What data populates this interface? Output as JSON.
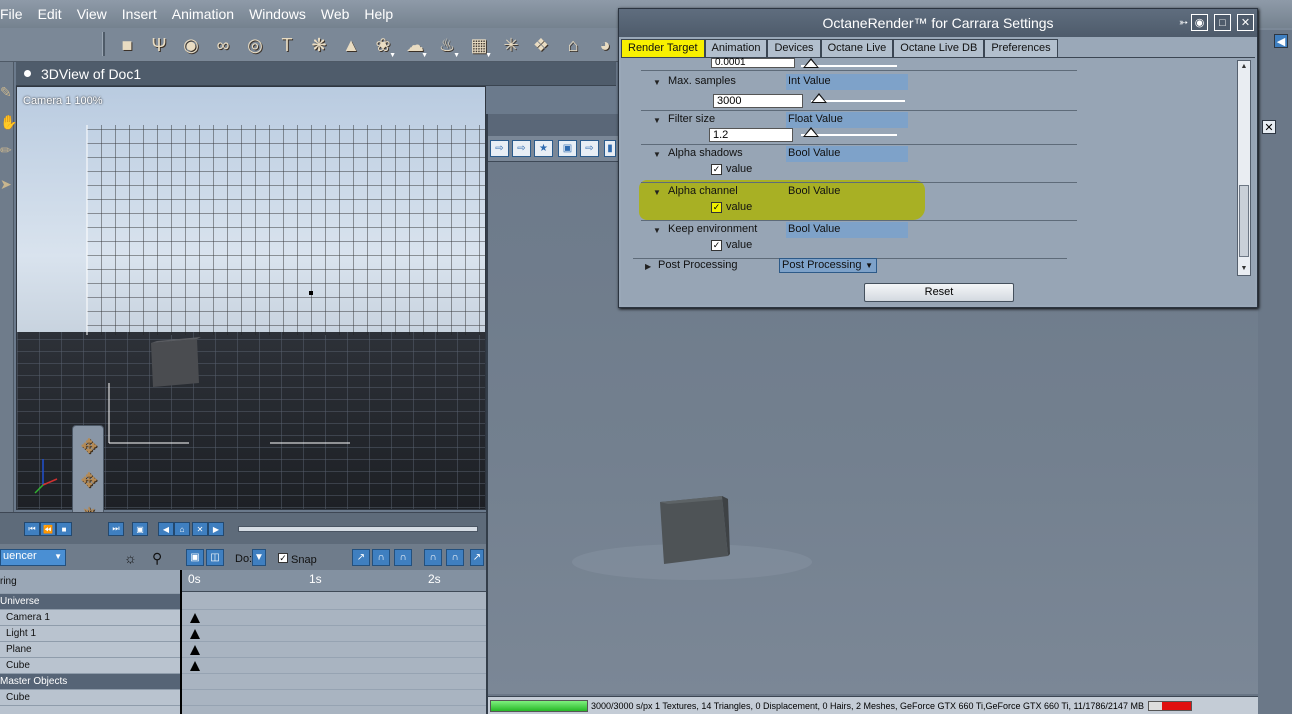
{
  "menubar": {
    "items": [
      "File",
      "Edit",
      "View",
      "Insert",
      "Animation",
      "Windows",
      "Web",
      "Help"
    ]
  },
  "toolbar": {
    "icons": [
      "cube-icon",
      "goblet-icon",
      "sphere-icon",
      "figure-icon",
      "torus-icon",
      "text-icon",
      "particles-icon",
      "terrain-icon",
      "plant-icon",
      "cloud-icon",
      "fire-icon",
      "ground-icon",
      "sparkle-icon",
      "film-icon",
      "house-icon",
      "bowl-icon"
    ]
  },
  "view3d": {
    "title": "3DView of Doc1",
    "camera_label": "Camera 1 100%"
  },
  "sequencer": {
    "mode": "uencer",
    "do_label": "Do:",
    "snap_label": "Snap",
    "snap_checked": true,
    "ruler": [
      "0s",
      "1s",
      "2s"
    ],
    "header_label": "ring",
    "tracks": [
      {
        "label": "Universe",
        "type": "group"
      },
      {
        "label": "Camera 1",
        "type": "item"
      },
      {
        "label": "Light 1",
        "type": "item"
      },
      {
        "label": "Plane",
        "type": "item"
      },
      {
        "label": "Cube",
        "type": "item"
      },
      {
        "label": "Master Objects",
        "type": "group"
      },
      {
        "label": "Cube",
        "type": "item"
      }
    ]
  },
  "render_window": {
    "status_text": "3000/3000 s/px 1 Textures, 14 Triangles, 0 Displacement, 0 Hairs, 2 Meshes, GeForce GTX 660 Ti,GeForce GTX 660 Ti, 11/1786/2147 MB",
    "progress_fraction": 1.0,
    "memory_fraction": 0.7
  },
  "dialog": {
    "title": "OctaneRender™ for Carrara Settings",
    "tabs": [
      "Render Target",
      "Animation",
      "Devices",
      "Octane Live",
      "Octane Live DB",
      "Preferences"
    ],
    "active_tab": "Render Target",
    "partial_value": "0.0001",
    "params": [
      {
        "name": "Max. samples",
        "type": "Int Value",
        "value": "3000"
      },
      {
        "name": "Filter size",
        "type": "Float Value",
        "value": "1.2"
      },
      {
        "name": "Alpha shadows",
        "type": "Bool Value",
        "value_label": "value",
        "checked": true
      },
      {
        "name": "Alpha channel",
        "type": "Bool Value",
        "value_label": "value",
        "checked": true
      },
      {
        "name": "Keep environment",
        "type": "Bool Value",
        "value_label": "value",
        "checked": true
      }
    ],
    "post_processing_label": "Post Processing",
    "post_processing_value": "Post Processing",
    "reset_label": "Reset"
  },
  "colors": {
    "active_tab": "#f8f000",
    "highlight": "#aab20a",
    "accent_blue": "#3f7fc0"
  }
}
